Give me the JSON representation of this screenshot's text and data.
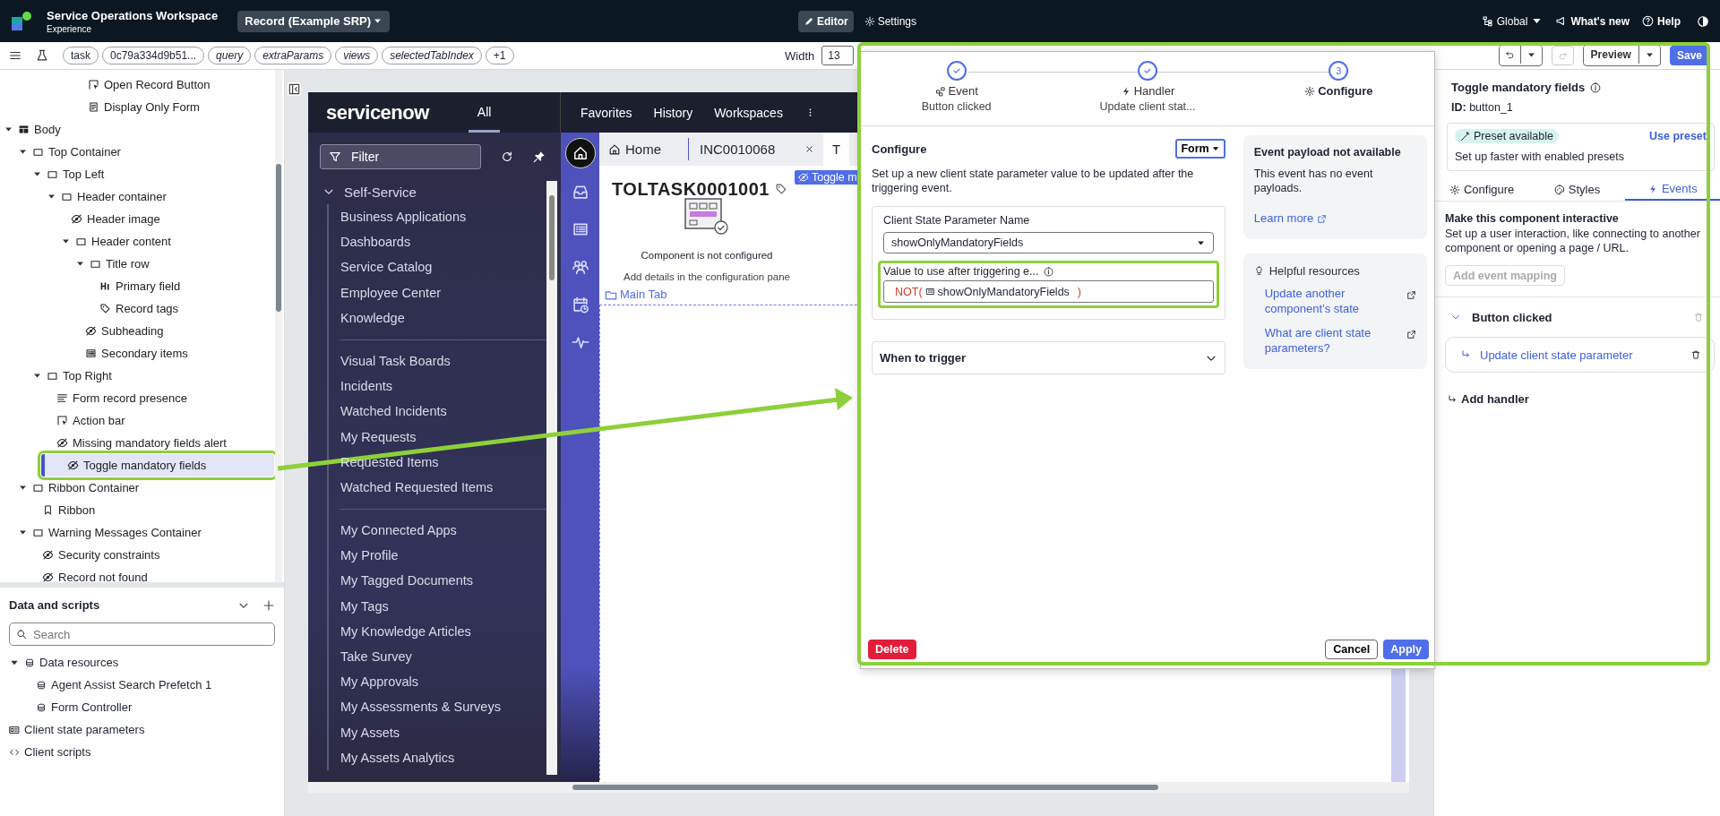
{
  "header": {
    "app_title": "Service Operations Workspace",
    "app_subtitle": "Experience",
    "page_selector": "Record (Example SRP)",
    "modes": [
      {
        "label": "Editor",
        "selected": true
      },
      {
        "label": "Settings",
        "selected": false
      }
    ],
    "scope": "Global",
    "whats_new": "What's new",
    "help": "Help"
  },
  "param_bar": {
    "params": [
      {
        "label": "task",
        "kind": "required"
      },
      {
        "label": "0c79a334d9b51...",
        "kind": "required"
      },
      {
        "label": "query",
        "kind": "optional"
      },
      {
        "label": "extraParams",
        "kind": "optional"
      },
      {
        "label": "views",
        "kind": "optional"
      },
      {
        "label": "selectedTabIndex",
        "kind": "optional"
      },
      {
        "label": "+1",
        "kind": "required"
      }
    ],
    "width_label": "Width",
    "width_value": "13",
    "preview": "Preview",
    "save": "Save"
  },
  "tree": {
    "scrolled_items": [
      {
        "label": "Open Record Button",
        "kind": "button",
        "selected": false
      },
      {
        "label": "Display Only Form",
        "kind": "form",
        "selected": false
      }
    ],
    "items": [
      {
        "label": "Body",
        "kind": "layout",
        "selected": false,
        "expanded": true,
        "children": [
          {
            "label": "Top Container",
            "kind": "container",
            "selected": false,
            "expanded": true,
            "children": [
              {
                "label": "Top Left",
                "kind": "container",
                "selected": false,
                "expanded": true,
                "children": [
                  {
                    "label": "Header container",
                    "kind": "container",
                    "selected": false,
                    "expanded": true,
                    "children": [
                      {
                        "label": "Header image",
                        "kind": "hidden",
                        "selected": false
                      },
                      {
                        "label": "Header content",
                        "kind": "container",
                        "selected": false,
                        "expanded": true,
                        "children": [
                          {
                            "label": "Title row",
                            "kind": "container",
                            "selected": false,
                            "expanded": true,
                            "children": [
                              {
                                "label": "Primary field",
                                "kind": "heading",
                                "selected": false
                              },
                              {
                                "label": "Record tags",
                                "kind": "tag",
                                "selected": false
                              }
                            ]
                          },
                          {
                            "label": "Subheading",
                            "kind": "hidden",
                            "selected": false
                          },
                          {
                            "label": "Secondary items",
                            "kind": "list",
                            "selected": false
                          }
                        ]
                      }
                    ]
                  }
                ]
              },
              {
                "label": "Top Right",
                "kind": "container",
                "selected": false,
                "expanded": true,
                "children": [
                  {
                    "label": "Form record presence",
                    "kind": "presence",
                    "selected": false
                  },
                  {
                    "label": "Action bar",
                    "kind": "button",
                    "selected": false
                  },
                  {
                    "label": "Missing mandatory fields alert",
                    "kind": "hidden",
                    "selected": false
                  },
                  {
                    "label": "Toggle mandatory fields",
                    "kind": "hidden",
                    "selected": true
                  }
                ]
              }
            ]
          },
          {
            "label": "Ribbon Container",
            "kind": "container",
            "selected": false,
            "expanded": true,
            "children": [
              {
                "label": "Ribbon",
                "kind": "bookmark",
                "selected": false
              }
            ]
          },
          {
            "label": "Warning Messages Container",
            "kind": "container",
            "selected": false,
            "expanded": true,
            "children": [
              {
                "label": "Security constraints",
                "kind": "hidden",
                "selected": false
              },
              {
                "label": "Record not found",
                "kind": "hidden",
                "selected": false
              }
            ]
          }
        ]
      }
    ]
  },
  "data_scripts": {
    "title": "Data and scripts",
    "search_placeholder": "Search",
    "items": [
      {
        "label": "Data resources",
        "kind": "database",
        "expanded": true,
        "children": [
          {
            "label": "Agent Assist Search Prefetch 1",
            "kind": "database"
          },
          {
            "label": "Form Controller",
            "kind": "database"
          }
        ]
      },
      {
        "label": "Client state parameters",
        "kind": "params"
      },
      {
        "label": "Client scripts",
        "kind": "code"
      }
    ]
  },
  "preview": {
    "logo": "servicenow",
    "nav_tabs": [
      {
        "label": "All",
        "selected": true
      }
    ],
    "menu": [
      "Favorites",
      "History",
      "Workspaces"
    ],
    "filter_placeholder": "Filter",
    "section": {
      "label": "Self-Service",
      "expanded": true
    },
    "groups": [
      [
        "Business Applications",
        "Dashboards",
        "Service Catalog",
        "Employee Center",
        "Knowledge"
      ],
      [
        "Visual Task Boards",
        "Incidents",
        "Watched Incidents",
        "My Requests",
        "Requested Items",
        "Watched Requested Items"
      ],
      [
        "My Connected Apps",
        "My Profile",
        "My Tagged Documents",
        "My Tags",
        "My Knowledge Articles",
        "Take Survey",
        "My Approvals",
        "My Assessments & Surveys",
        "My Assets",
        "My Assets Analytics"
      ]
    ],
    "tabs": [
      {
        "label": "Home",
        "kind": "home",
        "selected": false,
        "closable": false
      },
      {
        "label": "INC0010068",
        "kind": "record",
        "selected": false,
        "closable": true
      },
      {
        "label": "T",
        "kind": "record",
        "selected": true,
        "closable": false
      }
    ],
    "record_title": "TOLTASK0001001",
    "badge": "Toggle m",
    "empty_title": "Component is not configured",
    "empty_hint": "Add details in the configuration pane",
    "main_tab": "Main Tab"
  },
  "modal": {
    "steps": [
      {
        "label": "Event",
        "subtitle": "Button clicked",
        "done": true
      },
      {
        "label": "Handler",
        "subtitle": "Update client stat...",
        "done": true
      },
      {
        "label": "Configure",
        "number": "3",
        "done": false
      }
    ],
    "title": "Configure",
    "mode": "Form",
    "description": "Set up a new client state parameter value to be updated after the triggering event.",
    "param_label": "Client State Parameter Name",
    "param_value": "showOnlyMandatoryFields",
    "value_label": "Value to use after triggering e...",
    "expression": {
      "prefix": "NOT(",
      "token": "showOnlyMandatoryFields",
      "suffix": ")"
    },
    "trigger": {
      "label": "When to trigger",
      "expanded": false
    },
    "payload": {
      "title": "Event payload not available",
      "text": "This event has no event payloads.",
      "link": "Learn more"
    },
    "resources": {
      "title": "Helpful resources",
      "links": [
        "Update another component’s state",
        "What are client state parameters?"
      ]
    },
    "delete": "Delete",
    "cancel": "Cancel",
    "apply": "Apply"
  },
  "right_panel": {
    "title": "Toggle mandatory fields",
    "id": "**ID:** button_1",
    "preset_badge": "Preset available",
    "use_preset": "Use preset",
    "preset_hint": "Set up faster with enabled presets",
    "tabs": [
      {
        "label": "Configure",
        "selected": false
      },
      {
        "label": "Styles",
        "selected": false
      },
      {
        "label": "Events",
        "selected": true
      }
    ],
    "section_title": "Make this component interactive",
    "section_text": "Set up a user interaction, like connecting to another component or opening a page / URL.",
    "add_mapping": {
      "label": "Add event mapping",
      "disabled": true
    },
    "events": [
      {
        "label": "Button clicked",
        "expanded": true,
        "handlers": [
          "Update client state parameter"
        ]
      }
    ],
    "add_handler": "Add handler"
  }
}
